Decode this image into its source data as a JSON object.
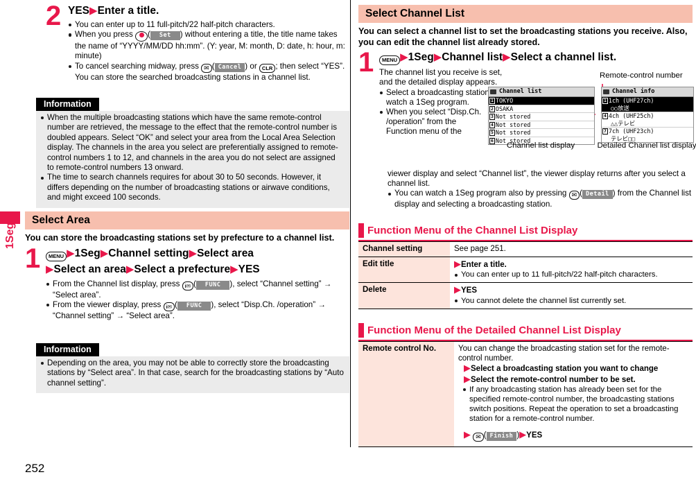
{
  "page": {
    "number": "252",
    "side_tab": "1Seg",
    "accent_red": "#e8174a",
    "pink_band": "#f7bfae",
    "table_key_bg": "#fde4dc",
    "info_bg": "#ebebeb"
  },
  "left": {
    "step2": {
      "num": "2",
      "head_a": "YES",
      "head_b": "Enter a title.",
      "bullets": [
        {
          "parts": [
            "You can enter up to 11 full-pitch/22 half-pitch characters."
          ]
        },
        {
          "pre": "When you press",
          "key": "center-select-key",
          "soft": "Set",
          "post": ") without entering a title, the title name takes the name of “YYYY/MM/DD hh:mm”. (Y: year, M: month, D: date, h: hour, m: minute)"
        },
        {
          "pre": "To cancel searching midway, press",
          "key": "mail-key",
          "soft": "Cancel",
          "mid": ") or",
          "key2": "CLR",
          "post": "; then select “YES”. You can store the searched broadcasting stations in a channel list."
        }
      ]
    },
    "info1": {
      "title": "Information",
      "items": [
        "When the multiple broadcasting stations which have the same remote-control number are retrieved, the message to the effect that the remote-control number is doubled appears. Select “OK” and select your area from the Local Area Selection display. The channels in the area you select are preferentially assigned to remote-control numbers 1 to 12, and channels in the area you do not select are assigned to remote-control numbers 13 onward.",
        "The time to search channels requires for about 30 to 50 seconds. However, it differs depending on the number of broadcasting stations or airwave conditions, and might exceed 100 seconds."
      ]
    },
    "select_area": {
      "heading": "Select Area",
      "lead": "You can store the broadcasting stations set by prefecture to a channel list.",
      "step": {
        "num": "1",
        "menu_key": "MENU",
        "chain1": [
          "1Seg",
          "Channel setting",
          "Select area"
        ],
        "chain2": [
          "Select an area",
          "Select a prefecture",
          "YES"
        ]
      },
      "notes": [
        {
          "pre": "From the Channel list display, press",
          "key": "i-mode-func-key",
          "soft": "FUNC",
          "post": "), select “Channel setting” → “Select area”."
        },
        {
          "pre": "From the viewer display, press",
          "key": "i-mode-func-key",
          "soft": "FUNC",
          "post": "), select “Disp.Ch. /operation” → “Channel setting” → “Select area”."
        }
      ]
    },
    "info2": {
      "title": "Information",
      "items": [
        "Depending on the area, you may not be able to correctly store the broadcasting stations by “Select area”. In that case, search for the broadcasting stations by “Auto channel setting”."
      ]
    }
  },
  "right": {
    "select_channel_list": {
      "heading": "Select Channel List",
      "lead": "You can select a channel list to set the broadcasting stations you receive. Also, you can edit the channel list already stored.",
      "step": {
        "num": "1",
        "menu_key": "MENU",
        "chain": [
          "1Seg",
          "Channel list",
          "Select a channel list."
        ]
      },
      "body_intro": "The channel list you receive is set, and the detailed display appears.",
      "bullets": [
        {
          "text": "Select a broadcasting station to watch a 1Seg program."
        },
        {
          "text": "When you select “Disp.Ch. /operation” from the Function menu of the viewer display and select “Channel list”, the viewer display returns after you select a channel list."
        },
        {
          "pre": "You can watch a 1Seg program also by pressing",
          "key": "mail-key",
          "soft": "Detail",
          "post": ") from the Channel list display and selecting a broadcasting station."
        }
      ],
      "callout": "Remote-control number",
      "screen_list": {
        "title": "Channel list",
        "caption": "Channel list display",
        "rows": [
          {
            "num": "1",
            "label": "TOKYO",
            "selected": true
          },
          {
            "num": "2",
            "label": "OSAKA",
            "selected": false
          },
          {
            "num": "3",
            "label": "Not stored",
            "selected": false
          },
          {
            "num": "4",
            "label": "Not stored",
            "selected": false
          },
          {
            "num": "5",
            "label": "Not stored",
            "selected": false
          },
          {
            "num": "6",
            "label": "Not stored",
            "selected": false
          }
        ]
      },
      "screen_info": {
        "title": "Channel info",
        "caption": "Detailed Channel list display",
        "rows": [
          {
            "num": "1",
            "line1": "1ch  (UHF27ch)",
            "line2": "○○放送",
            "selected": true
          },
          {
            "num": "4",
            "line1": "4ch  (UHF25ch)",
            "line2": "△△テレビ",
            "selected": false
          },
          {
            "num": "7",
            "line1": "7ch  (UHF23ch)",
            "line2": "テレビ□□",
            "selected": false
          }
        ]
      }
    },
    "fn_channel_list": {
      "heading": "Function Menu of the Channel List Display",
      "rows": [
        {
          "key": "Channel setting",
          "value_plain": "See page 251."
        },
        {
          "key": "Edit title",
          "value_head": "Enter a title.",
          "bullets": [
            "You can enter up to 11 full-pitch/22 half-pitch characters."
          ]
        },
        {
          "key": "Delete",
          "value_head": "YES",
          "bullets": [
            "You cannot delete the channel list currently set."
          ]
        }
      ]
    },
    "fn_detailed_list": {
      "heading": "Function Menu of the Detailed Channel List Display",
      "row": {
        "key": "Remote control No.",
        "intro": "You can change the broadcasting station set for the remote-control number.",
        "step_lines": [
          "Select a broadcasting station you want to change",
          "Select the remote-control number to be set."
        ],
        "bullets": [
          "If any broadcasting station has already been set for the specified remote-control number, the broadcasting stations switch positions. Repeat the operation to set a broadcasting station for a remote-control number."
        ],
        "final": {
          "key": "mail-key",
          "soft": "Finish",
          "post": "YES"
        }
      }
    }
  }
}
